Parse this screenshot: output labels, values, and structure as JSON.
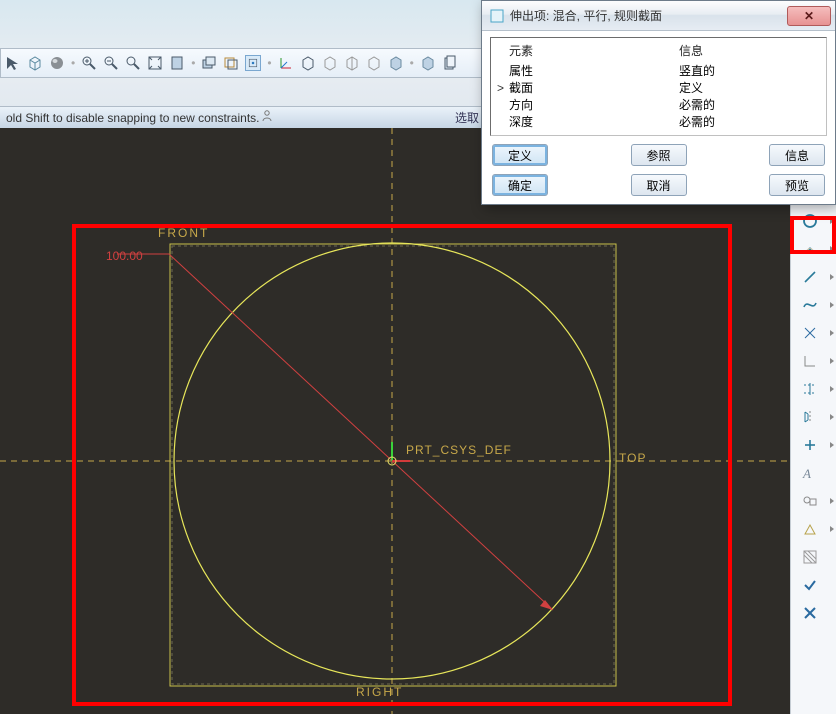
{
  "hint": {
    "text": "old Shift to disable snapping to new constraints.",
    "select_label": "选取"
  },
  "viewport": {
    "dim_value": "100.00",
    "label_front": "FRONT",
    "label_right": "RIGHT",
    "label_top": "TOP",
    "csys_label": "PRT_CSYS_DEF"
  },
  "dialog": {
    "title": "伸出项: 混合, 平行, 规则截面",
    "headers": {
      "elements": "元素",
      "info": "信息"
    },
    "rows": [
      {
        "mark": "",
        "name": "属性",
        "info": "竖直的"
      },
      {
        "mark": ">",
        "name": "截面",
        "info": "定义"
      },
      {
        "mark": "",
        "name": "方向",
        "info": "必需的"
      },
      {
        "mark": "",
        "name": "深度",
        "info": "必需的"
      }
    ],
    "buttons": {
      "define": "定义",
      "ref": "参照",
      "info": "信息",
      "ok": "确定",
      "cancel": "取消",
      "preview": "预览"
    }
  },
  "right_tools": [
    "rectangle-icon",
    "circle-icon",
    "point-icon",
    "line-icon",
    "spline-icon",
    "delete-point-icon",
    "corner-icon",
    "trim-horiz-icon",
    "mirror-icon",
    "plus-icon",
    "text-icon",
    "sketch-group-icon",
    "palette-icon",
    "hatch-icon",
    "check-icon",
    "close-icon"
  ],
  "toolbar_icons": [
    "select-arrow-icon",
    "cube-wire-icon",
    "sphere-icon",
    "zoom-in-icon",
    "zoom-out-icon",
    "zoom-window-icon",
    "zoom-fit-icon",
    "sheet-icon",
    "layers-icon",
    "planes-icon",
    "view-dot-icon",
    "csys-icon",
    "cube-icon",
    "box-icon",
    "box2-icon",
    "box3-icon",
    "box4-icon",
    "box5-icon",
    "docs-icon"
  ]
}
